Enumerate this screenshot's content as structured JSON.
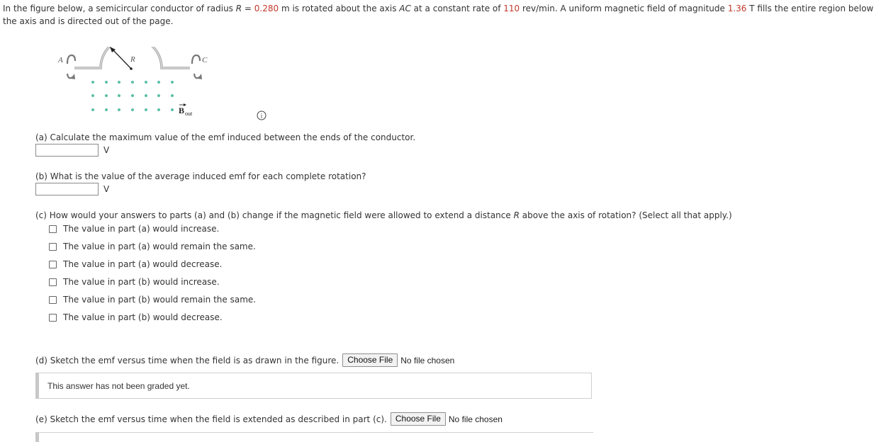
{
  "problem": {
    "intro_1": "In the figure below, a semicircular conductor of radius ",
    "R_var": "R",
    "intro_eq": " = ",
    "R_value": "0.280",
    "intro_2": " m is rotated about the axis ",
    "axis_label": "AC",
    "intro_3": " at a constant rate of ",
    "rate_value": "110",
    "intro_4": " rev/min. A uniform magnetic field of magnitude ",
    "B_value": "1.36",
    "intro_5": " T fills the entire region below the axis and is directed out of the page."
  },
  "figure": {
    "label_A": "A",
    "label_C": "C",
    "label_R": "R",
    "label_B": "B",
    "label_B_sub": "out"
  },
  "info_icon": "i",
  "part_a": {
    "question": "(a) Calculate the maximum value of the emf induced between the ends of the conductor.",
    "value": "",
    "unit": "V"
  },
  "part_b": {
    "question": "(b) What is the value of the average induced emf for each complete rotation?",
    "value": "",
    "unit": "V"
  },
  "part_c": {
    "question_1": "(c) How would your answers to parts (a) and (b) change if the magnetic field were allowed to extend a distance ",
    "question_var": "R",
    "question_2": " above the axis of rotation? (Select all that apply.)",
    "options": [
      "The value in part (a) would increase.",
      "The value in part (a) would remain the same.",
      "The value in part (a) would decrease.",
      "The value in part (b) would increase.",
      "The value in part (b) would remain the same.",
      "The value in part (b) would decrease."
    ]
  },
  "part_d": {
    "question": "(d) Sketch the emf versus time when the field is as drawn in the figure.",
    "button": "Choose File",
    "file_status": "No file chosen",
    "graded_status": "This answer has not been graded yet."
  },
  "part_e": {
    "question": "(e) Sketch the emf versus time when the field is extended as described in part (c).",
    "button": "Choose File",
    "file_status": "No file chosen"
  },
  "colors": {
    "highlight": "#c0392b",
    "dot": "#5bbfa6"
  }
}
